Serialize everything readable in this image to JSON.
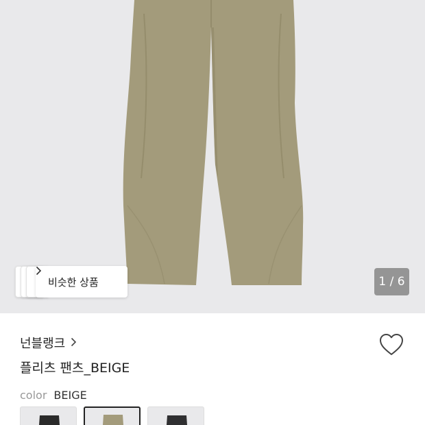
{
  "gallery": {
    "counter": "1 / 6",
    "similar_label": "비슷한 상품"
  },
  "product": {
    "brand": "넌블랭크",
    "title": "플리츠 팬츠_BEIGE",
    "color_label": "color",
    "color_value": "BEIGE"
  },
  "swatches": [
    {
      "name": "black",
      "color": "#2a2a2a"
    },
    {
      "name": "beige",
      "color": "#a39b7b",
      "selected": true
    },
    {
      "name": "charcoal",
      "color": "#2f2f31"
    }
  ],
  "colors": {
    "background": "#e9e9eb",
    "pants": "#a39b7b",
    "pants_shadow": "#8f8767"
  },
  "icons": {
    "similar_chevron": "chevron-right-icon",
    "brand_chevron": "chevron-right-icon",
    "wishlist": "heart-outline-icon"
  }
}
